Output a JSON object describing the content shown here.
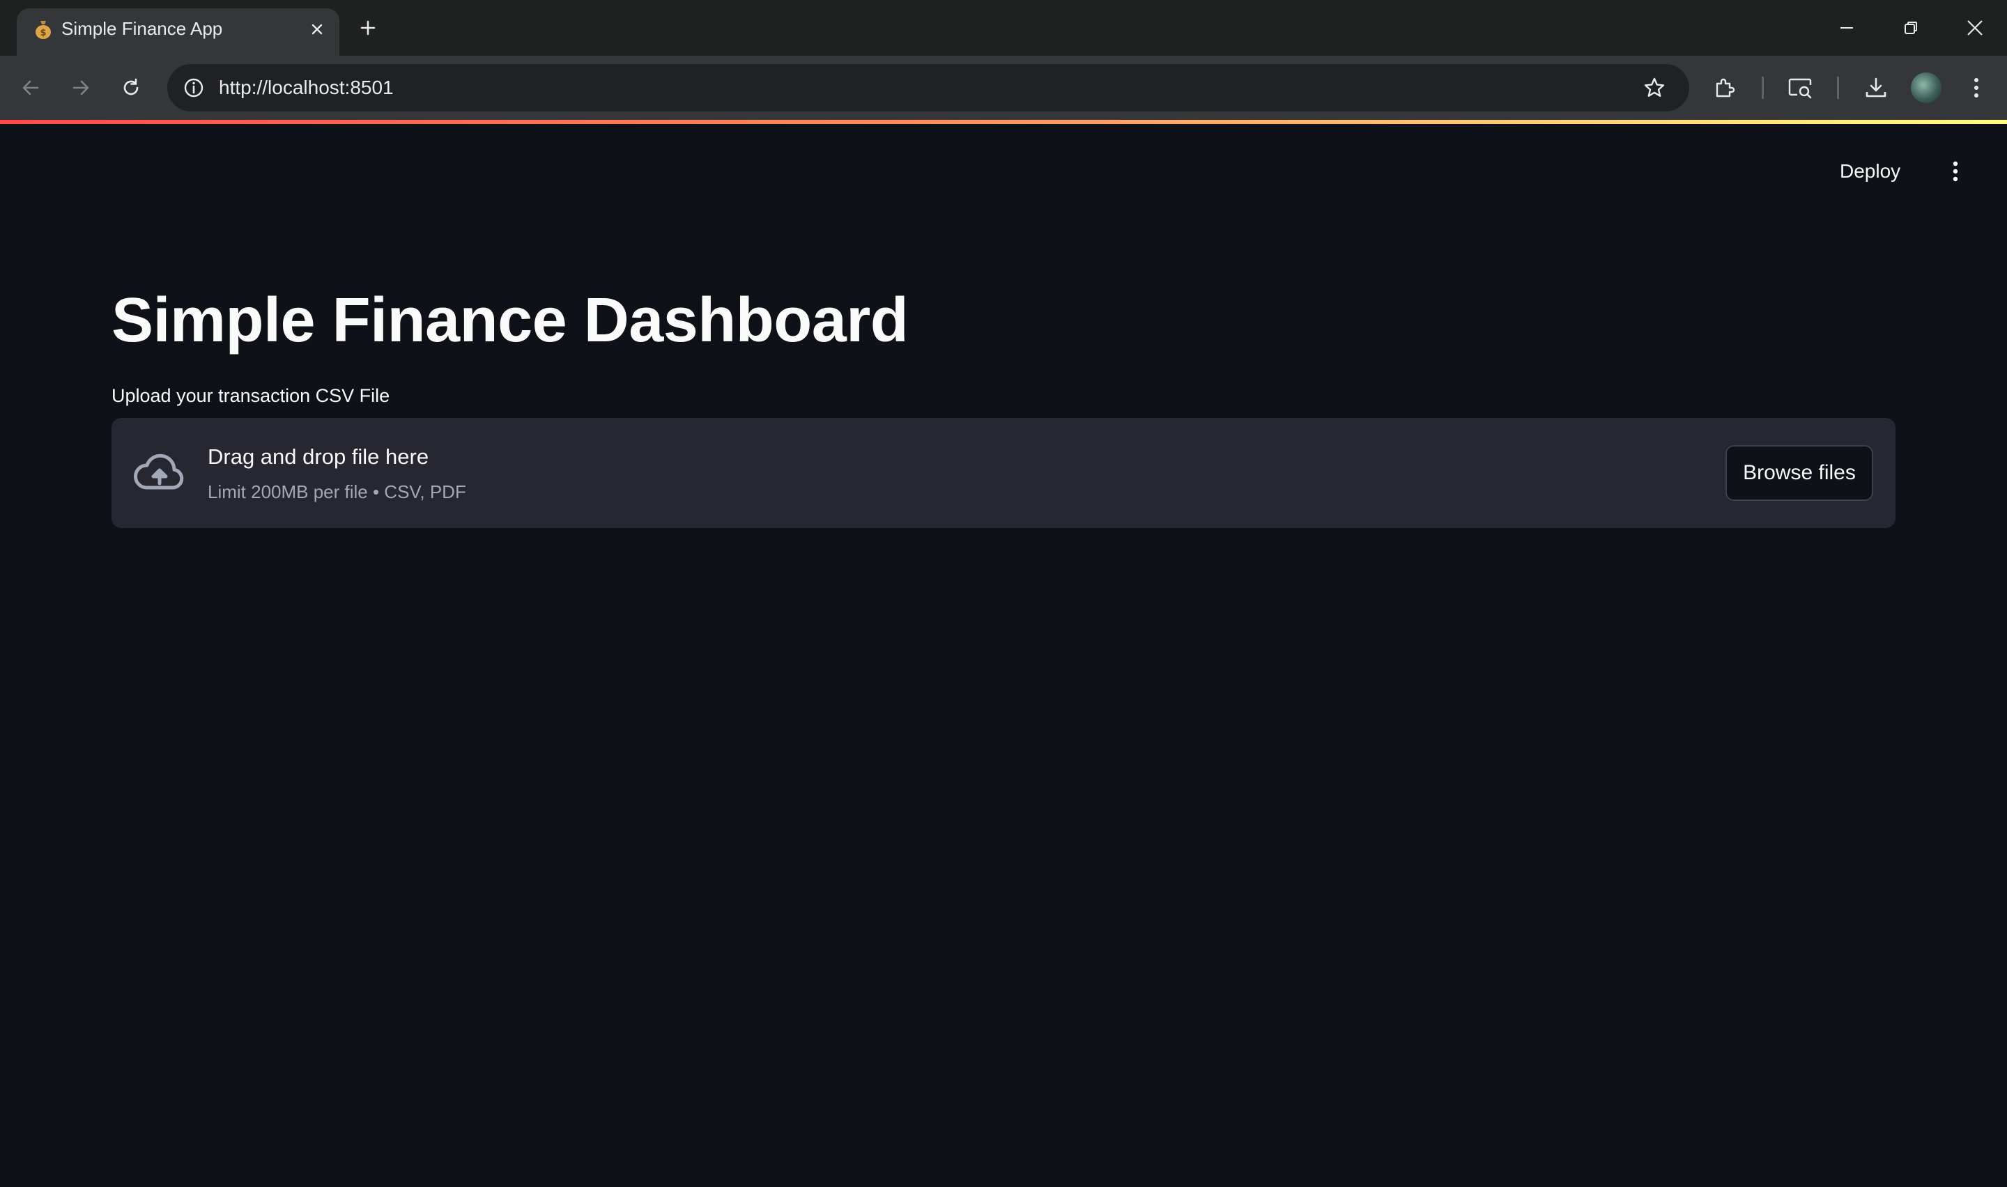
{
  "browser": {
    "tab_title": "Simple Finance App",
    "url": "http://localhost:8501",
    "favicon": "money-bag-icon"
  },
  "app": {
    "header": {
      "deploy_label": "Deploy"
    },
    "title": "Simple Finance Dashboard",
    "uploader": {
      "label": "Upload your transaction CSV File",
      "drop_text": "Drag and drop file here",
      "limit_text": "Limit 200MB per file • CSV, PDF",
      "button_label": "Browse files"
    }
  },
  "colors": {
    "app_background": "#0e1117",
    "dropzone_background": "#262730",
    "text_primary": "#fafafa",
    "text_secondary": "#a3a8b8",
    "chrome_tabbar": "#1f2020",
    "chrome_toolbar": "#35363a"
  }
}
